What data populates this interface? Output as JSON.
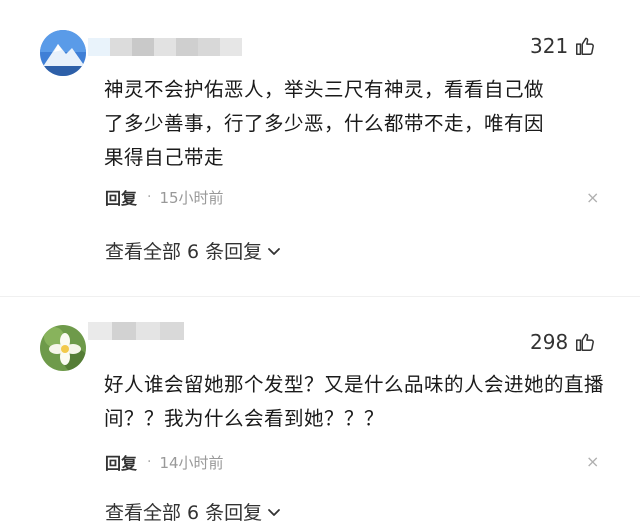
{
  "comments": [
    {
      "likes": "321",
      "content": "神灵不会护佑恶人，举头三尺有神灵，看看自己做了多少善事，行了多少恶，什么都带不走，唯有因果得自己带走",
      "reply_label": "回复",
      "separator": "·",
      "time": "15小时前",
      "close": "×",
      "view_all": "查看全部 6 条回复"
    },
    {
      "likes": "298",
      "content": "好人谁会留她那个发型？又是什么品味的人会进她的直播间？？我为什么会看到她？？？",
      "reply_label": "回复",
      "separator": "·",
      "time": "14小时前",
      "close": "×",
      "view_all": "查看全部 6 条回复"
    }
  ],
  "icons": {
    "like": "thumbs-up-icon",
    "close": "close-icon",
    "expand": "chevron-down-icon"
  }
}
